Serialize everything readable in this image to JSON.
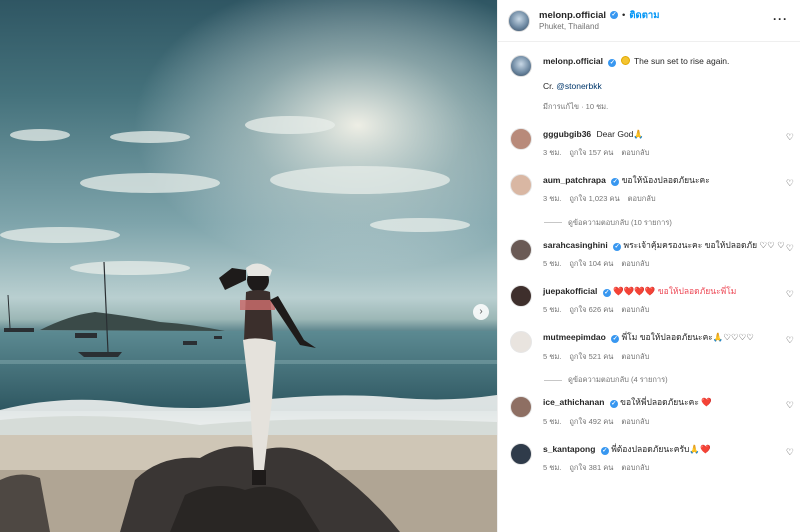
{
  "post_header": {
    "username": "melonp.official",
    "separator": "•",
    "follow_label": "ติดตาม",
    "location": "Phuket, Thailand",
    "more_icon": "more-horizontal-icon"
  },
  "caption": {
    "username": "melonp.official",
    "text": "The sun set to rise again.",
    "credit_prefix": "Cr.",
    "credit_mention": "@stonerbkk",
    "time": "มีการแก้ไข · 10 ชม."
  },
  "comments": [
    {
      "username": "gggubgib36",
      "verified": false,
      "text": "Dear God🙏",
      "time": "3 ชม.",
      "likes": "ถูกใจ 157 คน",
      "reply": "ตอบกลับ",
      "avatar_color": "#b88a7a"
    },
    {
      "username": "aum_patchrapa",
      "verified": true,
      "text": "ขอให้น้องปลอดภัยนะคะ",
      "time": "3 ชม.",
      "likes": "ถูกใจ 1,023 คน",
      "reply": "ตอบกลับ",
      "avatar_color": "#d9b7a3"
    },
    {
      "username": "sarahcasinghini",
      "verified": true,
      "text": "พระเจ้าคุ้มครองนะคะ ขอให้ปลอดภัย ♡♡ ♡",
      "time": "5 ชม.",
      "likes": "ถูกใจ 104 คน",
      "reply": "ตอบกลับ",
      "avatar_color": "#6a5a55"
    },
    {
      "username": "juepakofficial",
      "verified": true,
      "text": "❤️❤️❤️❤️ ขอให้ปลอดภัยนะพี่โม",
      "time": "5 ชม.",
      "likes": "ถูกใจ 626 คน",
      "reply": "ตอบกลับ",
      "avatar_color": "#3e2f2c"
    },
    {
      "username": "mutmeepimdao",
      "verified": true,
      "text": "พี่โม ขอให้ปลอดภัยนะคะ🙏♡♡♡♡",
      "time": "5 ชม.",
      "likes": "ถูกใจ 521 คน",
      "reply": "ตอบกลับ",
      "avatar_color": "#e9e4df"
    },
    {
      "username": "ice_athichanan",
      "verified": true,
      "text": "ขอให้พี่ปลอดภัยนะคะ ❤️",
      "time": "5 ชม.",
      "likes": "ถูกใจ 492 คน",
      "reply": "ตอบกลับ",
      "avatar_color": "#8e6f63"
    },
    {
      "username": "s_kantapong",
      "verified": true,
      "text": "พี่ต้องปลอดภัยนะครับ🙏❤️",
      "time": "5 ชม.",
      "likes": "ถูกใจ 381 คน",
      "reply": "ตอบกลับ",
      "avatar_color": "#2f3b4a"
    }
  ],
  "view_replies": [
    {
      "label": "ดูข้อความตอบกลับ (10 รายการ)"
    },
    {
      "label": "ดูข้อความตอบกลับ (4 รายการ)"
    }
  ]
}
